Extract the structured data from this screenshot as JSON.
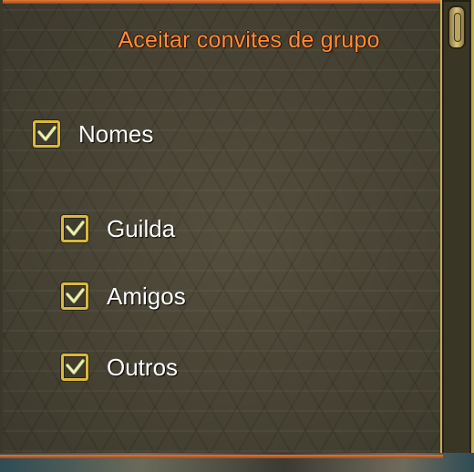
{
  "window": {
    "title": "Aceitar convites de grupo"
  },
  "options": {
    "nomes": {
      "label": "Nomes",
      "checked": true
    },
    "guilda": {
      "label": "Guilda",
      "checked": true
    },
    "amigos": {
      "label": "Amigos",
      "checked": true
    },
    "outros": {
      "label": "Outros",
      "checked": true
    }
  },
  "icons": {
    "checkbox": "checkmark-icon",
    "scroll": "scroll-thumb"
  },
  "colors": {
    "title": "#ff8c3c",
    "frame_gold": "#c6ad52",
    "frame_orange": "#e07a35",
    "panel_bg": "#4a4636",
    "label_text": "#ffffff"
  }
}
